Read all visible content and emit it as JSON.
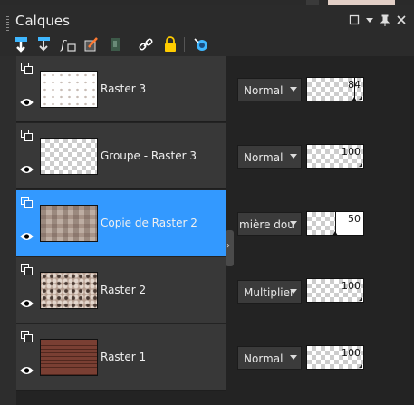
{
  "palette": {
    "title": "Calques",
    "header_icons": [
      "restore-icon",
      "menu-arrow-icon",
      "pin-icon",
      "close-icon"
    ],
    "toolbar_icons": [
      "new-layer-icon",
      "new-vector-icon",
      "new-group-icon",
      "blend-mask-icon",
      "delete-layer-icon",
      "link-icon",
      "lock-icon",
      "visibility-icon"
    ]
  },
  "layers": [
    {
      "name": "Raster 3",
      "blend": "Normal",
      "opacity": "84",
      "selected": false,
      "thumb": "dots"
    },
    {
      "name": "Groupe - Raster 3",
      "blend": "Normal",
      "opacity": "100",
      "selected": false,
      "thumb": "checker"
    },
    {
      "name": "Copie de Raster 2",
      "blend": "mière dou",
      "opacity": "50",
      "selected": true,
      "thumb": "mosaic"
    },
    {
      "name": "Raster 2",
      "blend": "Multiplier",
      "opacity": "100",
      "selected": false,
      "thumb": "pattern"
    },
    {
      "name": "Raster 1",
      "blend": "Normal",
      "opacity": "100",
      "selected": false,
      "thumb": "wood"
    }
  ],
  "colors": {
    "selection": "#3399ff",
    "row": "#383838",
    "background": "#232323"
  }
}
